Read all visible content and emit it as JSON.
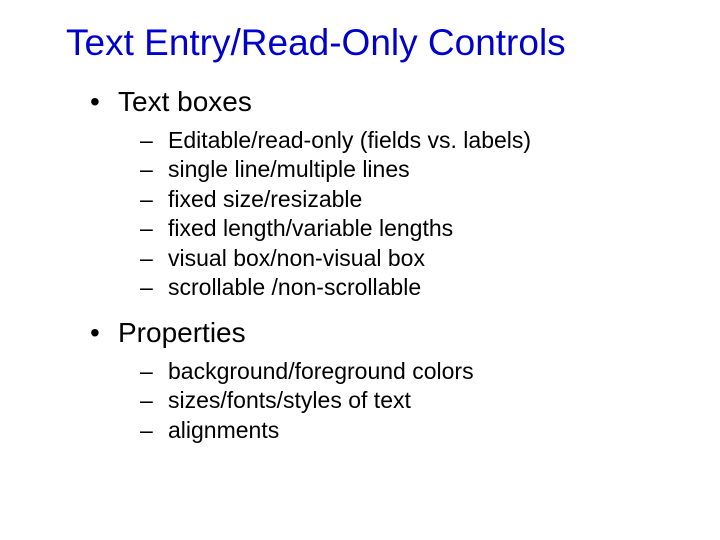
{
  "title": "Text Entry/Read-Only Controls",
  "sections": [
    {
      "label": "Text boxes",
      "items": [
        "Editable/read-only  (fields vs. labels)",
        "single line/multiple lines",
        "fixed size/resizable",
        "fixed length/variable lengths",
        "visual box/non-visual box",
        "scrollable /non-scrollable"
      ]
    },
    {
      "label": "Properties",
      "items": [
        "background/foreground colors",
        "sizes/fonts/styles of text",
        "alignments"
      ]
    }
  ],
  "bullet_l1": "•",
  "bullet_l2": "–"
}
